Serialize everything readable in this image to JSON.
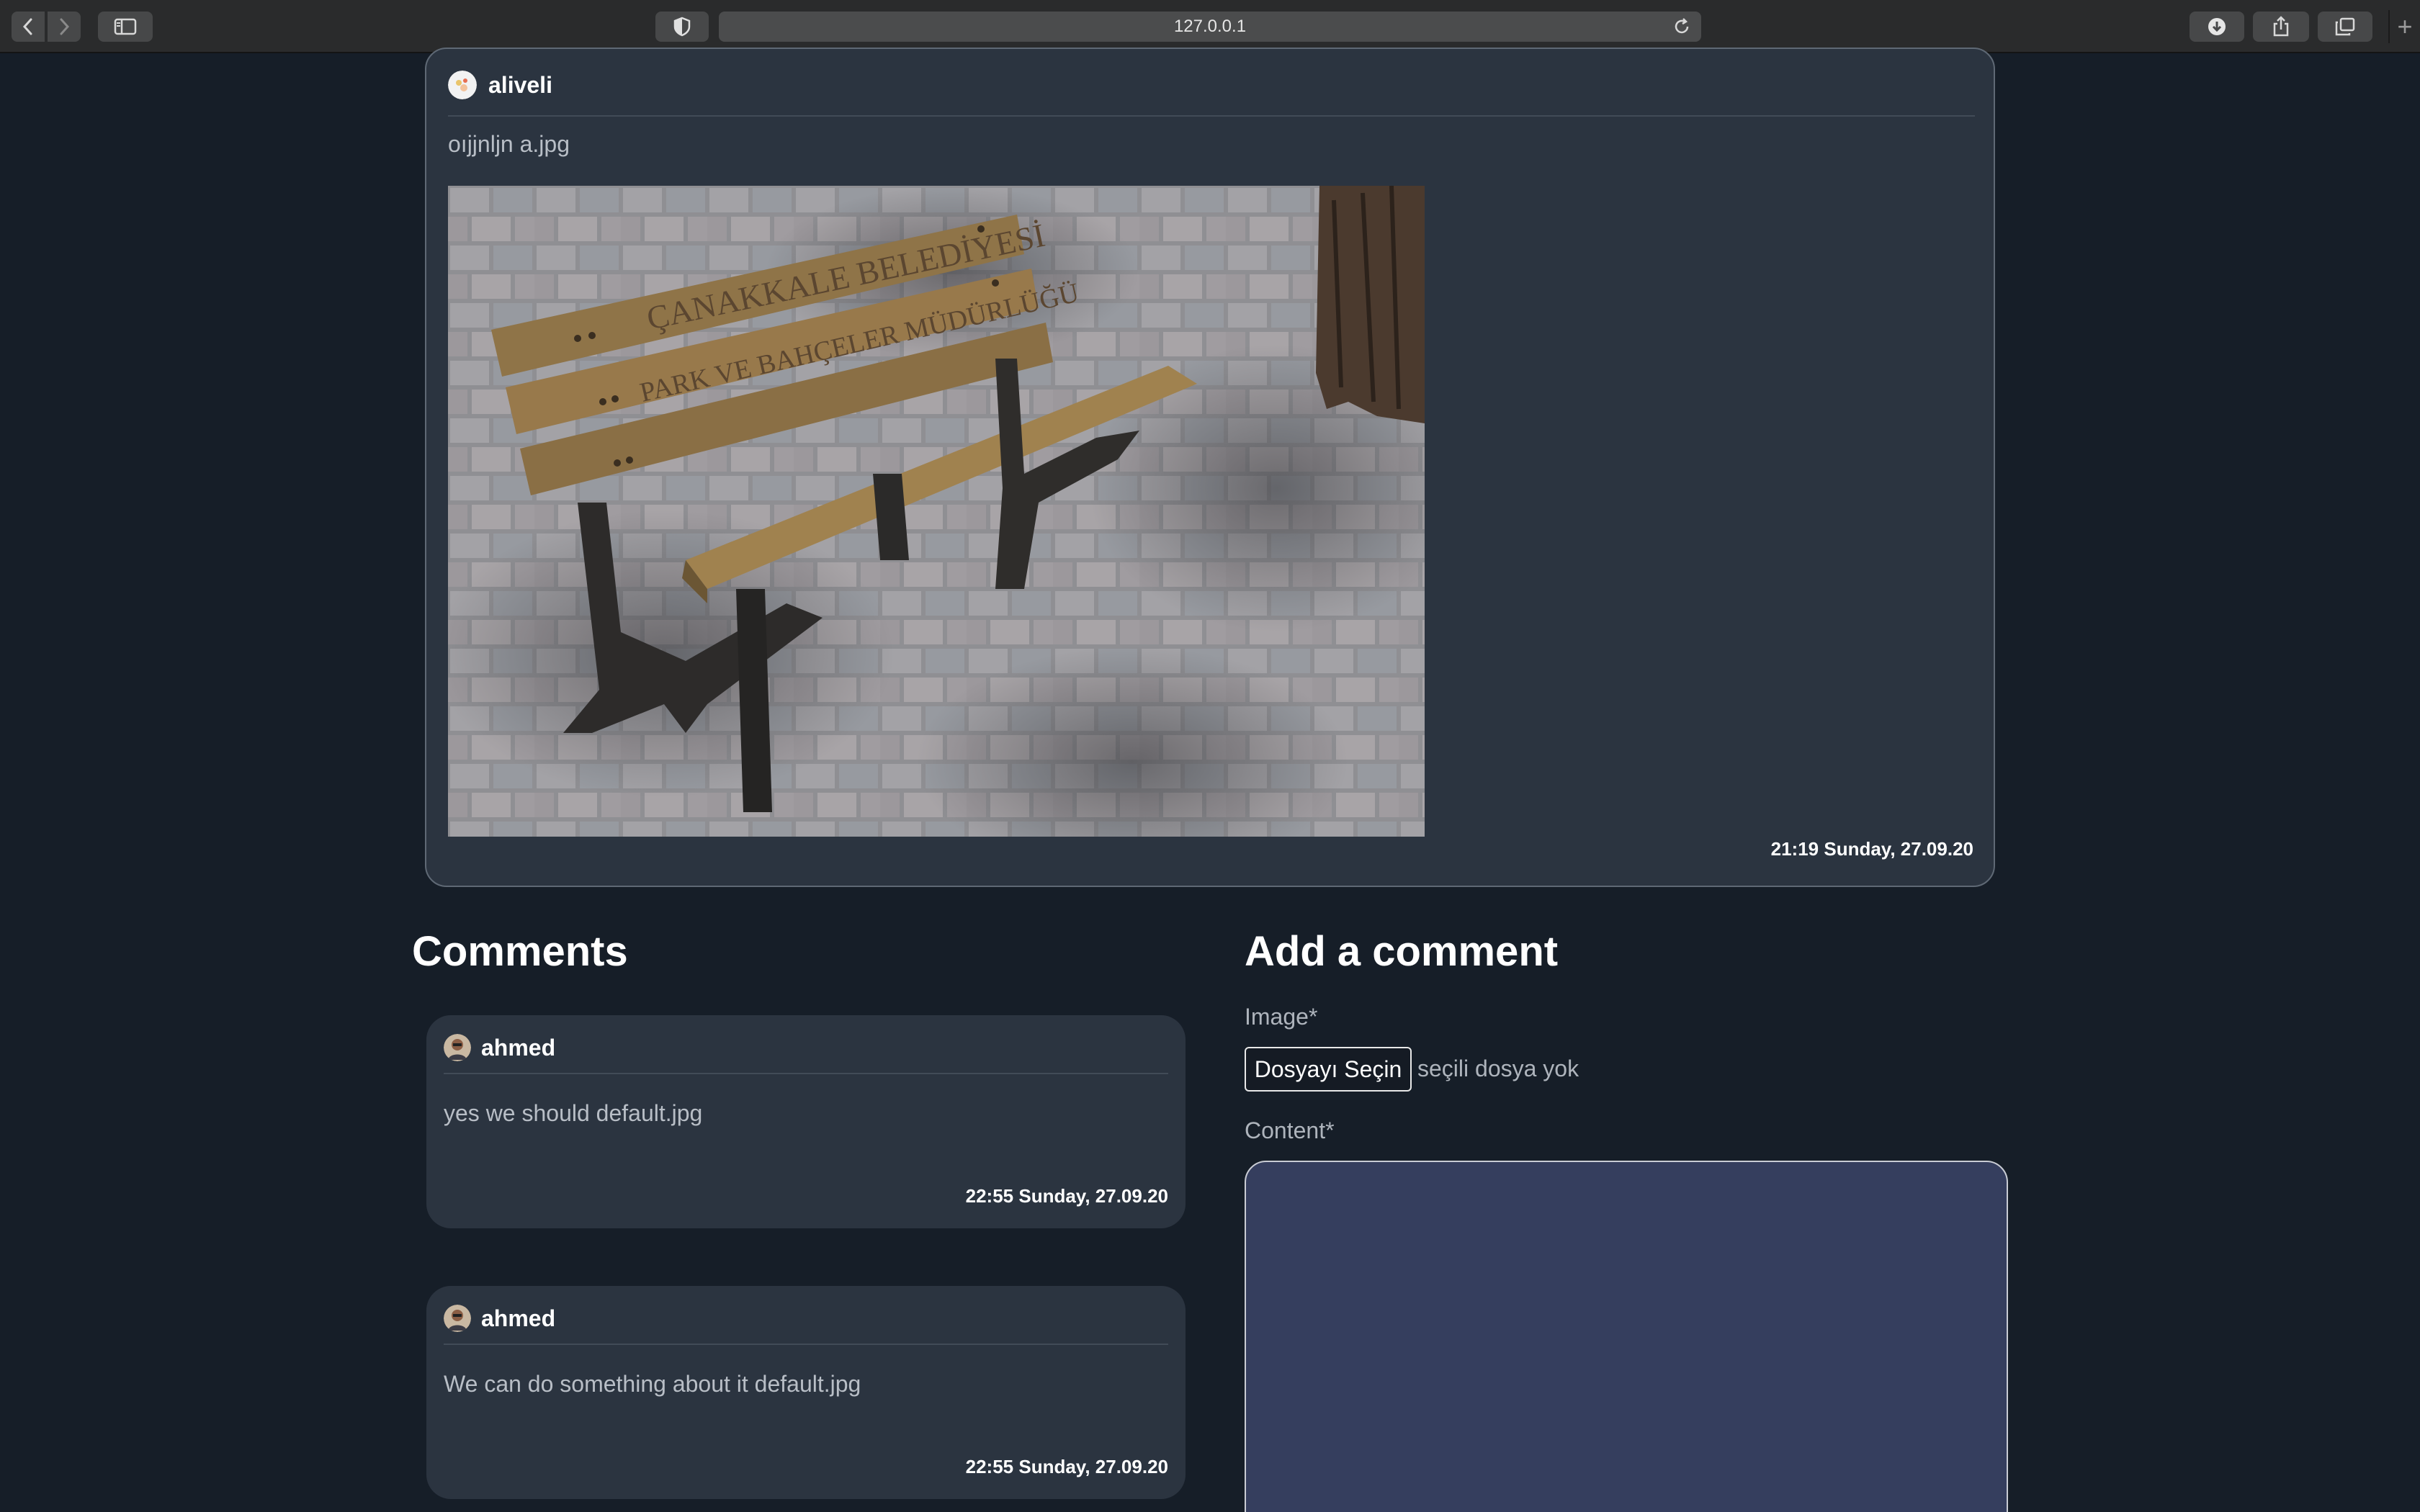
{
  "browser": {
    "url": "127.0.0.1"
  },
  "post": {
    "author": "aliveli",
    "text": "oıjjnljn a.jpg",
    "timestamp": "21:19 Sunday, 27.09.20",
    "image_alt": "Wooden park bench on paving stones under tree shade"
  },
  "comments_section": {
    "title": "Comments",
    "items": [
      {
        "author": "ahmed",
        "text": "yes we should default.jpg",
        "timestamp": "22:55 Sunday, 27.09.20"
      },
      {
        "author": "ahmed",
        "text": "We can do something about it default.jpg",
        "timestamp": "22:55 Sunday, 27.09.20"
      }
    ]
  },
  "add_comment": {
    "title": "Add a comment",
    "image_label": "Image*",
    "file_button": "Dosyayı Seçin",
    "file_status": "seçili dosya yok",
    "content_label": "Content*"
  }
}
